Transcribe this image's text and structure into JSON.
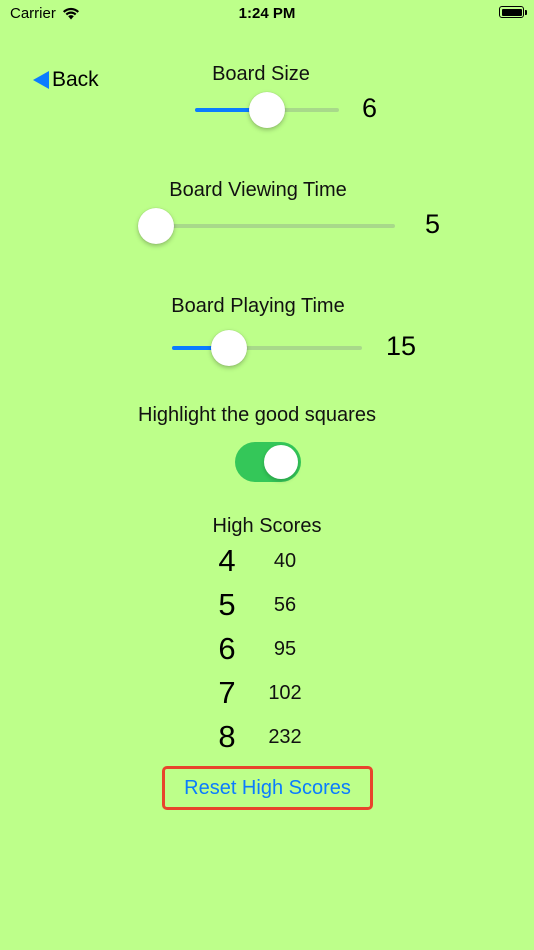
{
  "status": {
    "carrier": "Carrier",
    "time": "1:24 PM",
    "wifi_icon": "wifi-icon",
    "battery_level": 1.0
  },
  "nav": {
    "back_label": "Back",
    "back_icon": "back-triangle-icon",
    "accent": "#0a7cff"
  },
  "board_size": {
    "label": "Board Size",
    "value": "6",
    "fill_fraction": 0.5
  },
  "board_viewing_time": {
    "label": "Board Viewing Time",
    "value": "5",
    "fill_fraction": 0.0
  },
  "board_playing_time": {
    "label": "Board Playing Time",
    "value": "15",
    "fill_fraction": 0.3
  },
  "highlight": {
    "label": "Highlight the good squares",
    "on": true,
    "color": "#34c759"
  },
  "high_scores": {
    "title": "High Scores",
    "rows": [
      {
        "size": "4",
        "score": "40"
      },
      {
        "size": "5",
        "score": "56"
      },
      {
        "size": "6",
        "score": "95"
      },
      {
        "size": "7",
        "score": "102"
      },
      {
        "size": "8",
        "score": "232"
      }
    ]
  },
  "reset": {
    "label": "Reset High Scores",
    "border_color": "#e8442c"
  },
  "colors": {
    "background": "#bdff8a"
  }
}
